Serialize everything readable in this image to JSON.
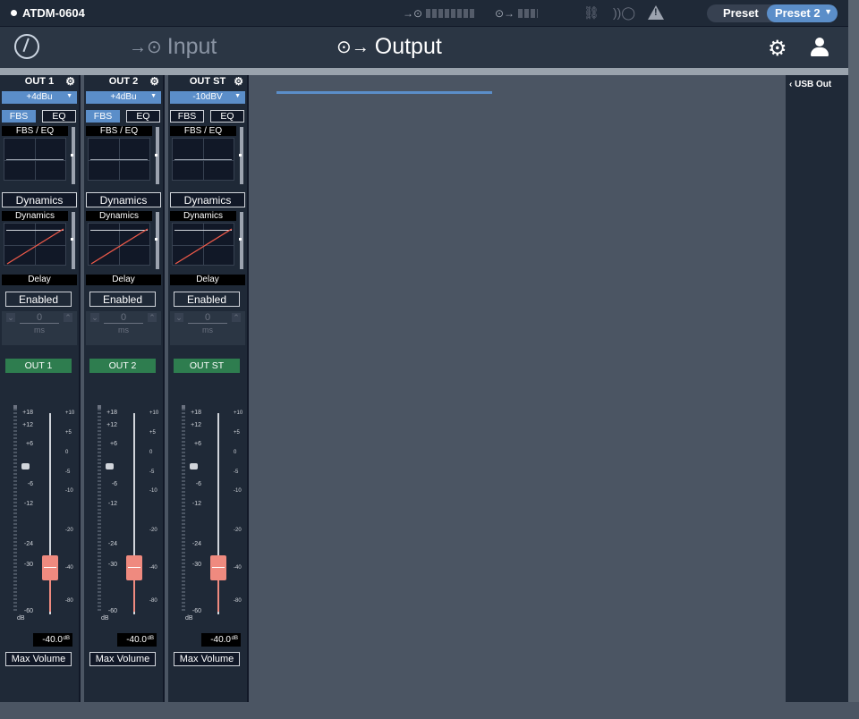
{
  "topbar": {
    "device_name": "ATDM-0604",
    "preset_label": "Preset",
    "preset_value": "Preset 2"
  },
  "nav": {
    "tabs": [
      {
        "label": "Input",
        "active": false
      },
      {
        "label": "Output",
        "active": true
      }
    ]
  },
  "channels": [
    {
      "name": "OUT 1",
      "level": "+4dBu",
      "fbs_label": "FBS",
      "eq_label": "EQ",
      "fbs_active": true,
      "fbs_eq_title": "FBS / EQ",
      "dynamics_button": "Dynamics",
      "dynamics_title": "Dynamics",
      "delay_title": "Delay",
      "delay_button": "Enabled",
      "delay_value": "0",
      "delay_unit": "ms",
      "output_label": "OUT 1",
      "fader_value": "-40.0",
      "fader_unit": "dB",
      "max_volume": "Max Volume"
    },
    {
      "name": "OUT 2",
      "level": "+4dBu",
      "fbs_label": "FBS",
      "eq_label": "EQ",
      "fbs_active": true,
      "fbs_eq_title": "FBS / EQ",
      "dynamics_button": "Dynamics",
      "dynamics_title": "Dynamics",
      "delay_title": "Delay",
      "delay_button": "Enabled",
      "delay_value": "0",
      "delay_unit": "ms",
      "output_label": "OUT 2",
      "fader_value": "-40.0",
      "fader_unit": "dB",
      "max_volume": "Max Volume"
    },
    {
      "name": "OUT ST",
      "level": "-10dBV",
      "fbs_label": "FBS",
      "eq_label": "EQ",
      "fbs_active": false,
      "fbs_eq_title": "FBS / EQ",
      "dynamics_button": "Dynamics",
      "dynamics_title": "Dynamics",
      "delay_title": "Delay",
      "delay_button": "Enabled",
      "delay_value": "0",
      "delay_unit": "ms",
      "output_label": "OUT ST",
      "fader_value": "-40.0",
      "fader_unit": "dB",
      "max_volume": "Max Volume"
    }
  ],
  "fader_scale": {
    "left": [
      "+18",
      "+12",
      "+6",
      "-6",
      "-12",
      "-24",
      "-30",
      "-60"
    ],
    "right": [
      "+10",
      "+5",
      "0",
      "-5",
      "-10",
      "-20",
      "-40",
      "-80"
    ],
    "db_label": "dB"
  },
  "side_panel": {
    "label": "USB Out"
  },
  "colors": {
    "accent_blue": "#5b8ec9",
    "output_green": "#2e7d4f",
    "fader_knob": "#ef8a7f"
  }
}
